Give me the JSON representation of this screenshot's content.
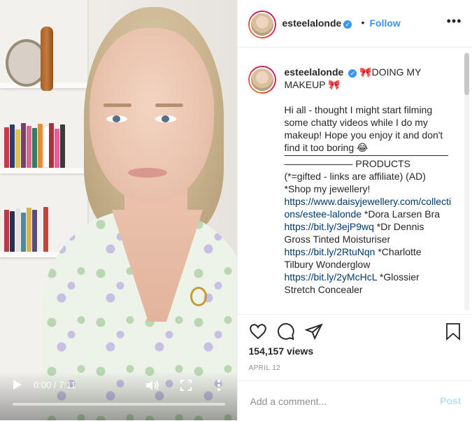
{
  "video": {
    "current_time": "0:00",
    "separator": " / ",
    "duration": "7:11",
    "progress": 0
  },
  "header": {
    "username": "esteelalonde",
    "verified_icon": "verified-badge-icon",
    "separator": "•",
    "follow_label": "Follow",
    "more_label": "•••"
  },
  "caption": {
    "username": "esteelalonde",
    "title": "🎀DOING MY MAKEUP 🎀",
    "intro": "Hi all - thought I might start filming some chatty videos while I do my makeup! Hope you enjoy it and don't find it too boring 😂",
    "divider_label": "——————— PRODUCTS",
    "line_gifted": "(*=gifted - links are affiliate) (AD)",
    "line_shop": "*Shop my jewellery!",
    "link_1": "https://www.daisyjewellery.com/collections/estee-lalonde",
    "text_1": " *Dora Larsen Bra",
    "link_2": "https://bit.ly/3ejP9wq",
    "text_2": " *Dr Dennis Gross Tinted Moisturiser",
    "link_3": "https://bit.ly/2RtuNqn",
    "text_3": " *Charlotte Tilbury Wonderglow",
    "link_4": "https://bit.ly/2yMcHcL",
    "text_4": " *Glossier Stretch Concealer"
  },
  "stats": {
    "views": "154,157 views",
    "date": "APRIL 12"
  },
  "comment": {
    "placeholder": "Add a comment...",
    "post_label": "Post"
  },
  "colors": {
    "accent": "#3897f0",
    "link": "#00376b",
    "muted": "#8e8e8e",
    "post_disabled": "#b2dffc"
  }
}
